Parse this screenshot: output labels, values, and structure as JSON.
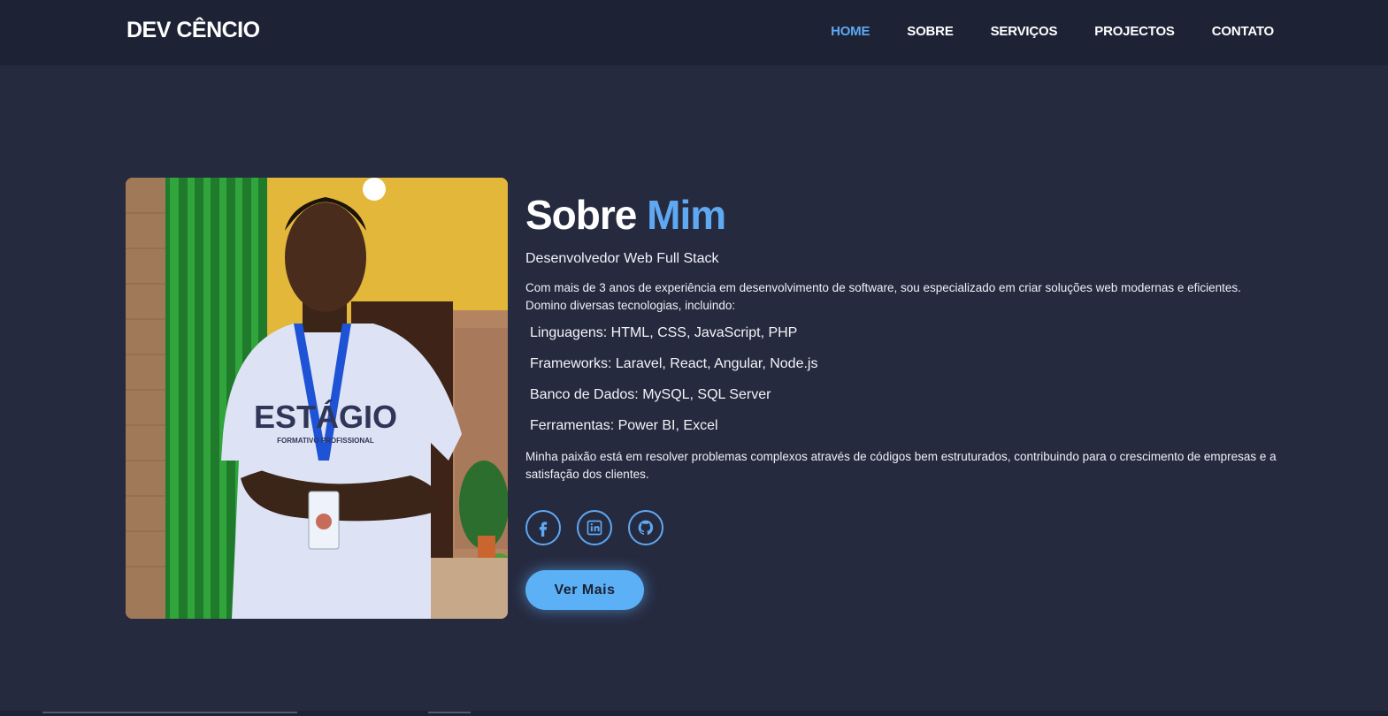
{
  "header": {
    "brand": "DEV CÊNCIO",
    "nav": [
      {
        "label": "HOME",
        "active": true
      },
      {
        "label": "SOBRE",
        "active": false
      },
      {
        "label": "SERVIÇOS",
        "active": false
      },
      {
        "label": "PROJECTOS",
        "active": false
      },
      {
        "label": "CONTATO",
        "active": false
      }
    ]
  },
  "about": {
    "title_main": "Sobre",
    "title_accent": "Mim",
    "subtitle": "Desenvolvedor Web Full Stack",
    "intro": "Com mais de 3 anos de experiência em desenvolvimento de software, sou especializado em criar soluções web modernas e eficientes. Domino diversas tecnologias, incluindo:",
    "skills": [
      "Linguagens: HTML, CSS, JavaScript, PHP",
      "Frameworks: Laravel, React, Angular, Node.js",
      "Banco de Dados: MySQL, SQL Server",
      "Ferramentas: Power BI, Excel"
    ],
    "closing": "Minha paixão está em resolver problemas complexos através de códigos bem estruturados, contribuindo para o crescimento de empresas e a satisfação dos clientes.",
    "socials": [
      {
        "icon": "facebook-icon"
      },
      {
        "icon": "linkedin-icon"
      },
      {
        "icon": "github-icon"
      }
    ],
    "cta_label": "Ver Mais",
    "photo": {
      "badge_text": "ESTÁGIO",
      "badge_subtext": "FORMATIVO PROFISSIONAL"
    }
  },
  "colors": {
    "accent": "#5fa8f2",
    "background": "#262a3f",
    "header_bg": "#1d2234",
    "button": "#5bb0f6"
  }
}
